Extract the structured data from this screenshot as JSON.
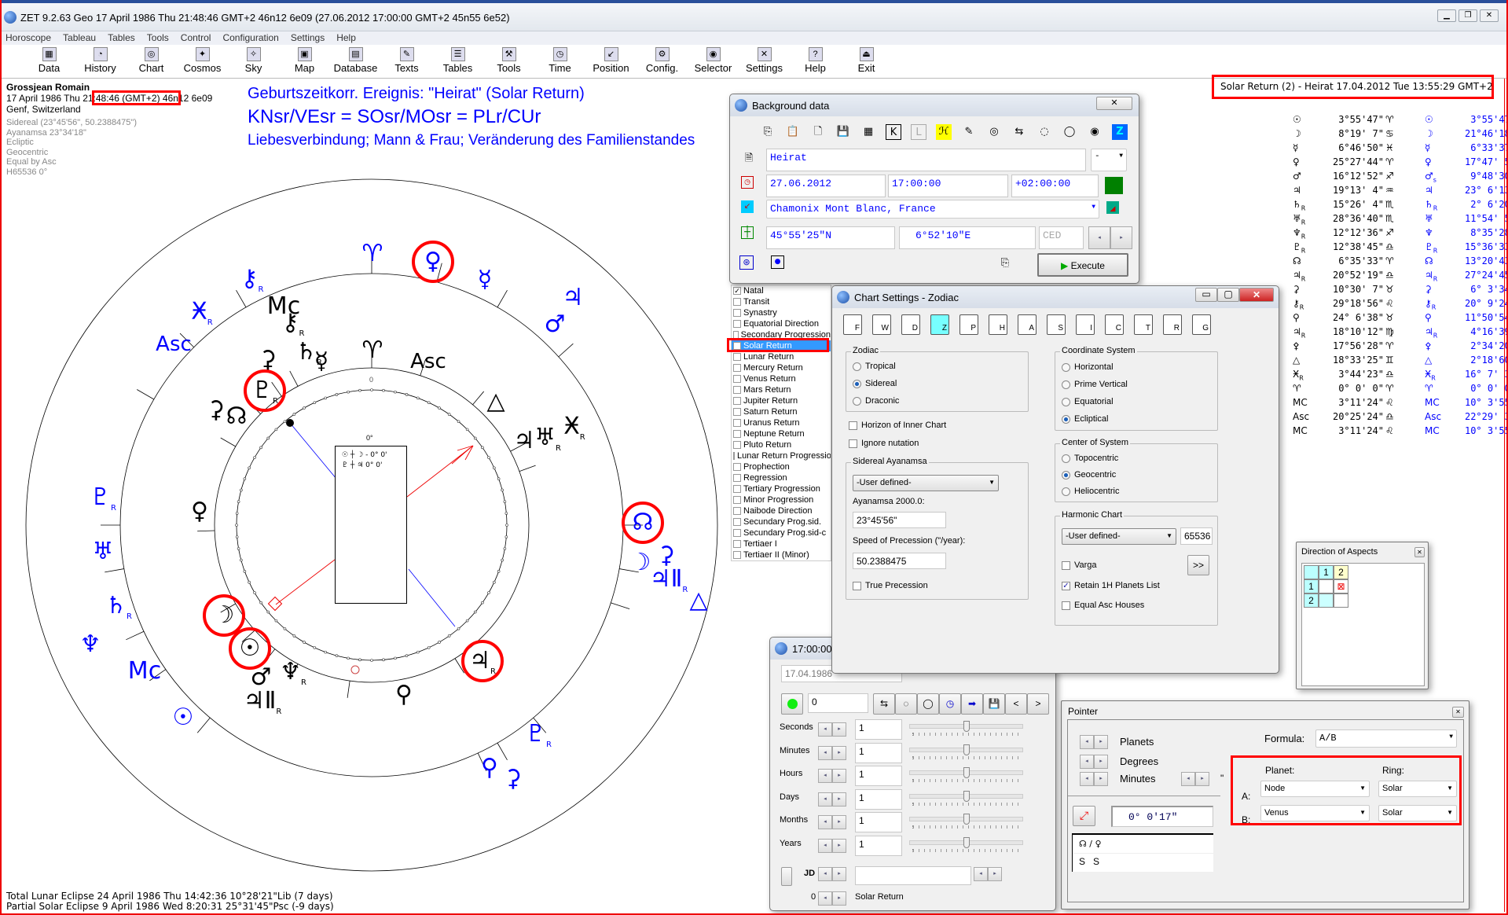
{
  "window": {
    "title": "ZET 9.2.63 Geo   17 April 1986  Thu  21:48:46 GMT+2 46n12  6e09  (27.06.2012  17:00:00 GMT+2 45n55 6e52)",
    "controls": [
      "minimize",
      "restore",
      "close"
    ]
  },
  "menu": [
    "Horoscope",
    "Tableau",
    "Tables",
    "Tools",
    "Control",
    "Configuration",
    "Settings",
    "Help"
  ],
  "toolbar": [
    {
      "label": "Data",
      "icon": "data-icon"
    },
    {
      "label": "History",
      "icon": "history-icon"
    },
    {
      "label": "Chart",
      "icon": "chart-icon"
    },
    {
      "label": "Cosmos",
      "icon": "cosmos-icon"
    },
    {
      "label": "Sky",
      "icon": "sky-icon"
    },
    {
      "label": "Map",
      "icon": "map-icon"
    },
    {
      "label": "Database",
      "icon": "database-icon"
    },
    {
      "label": "Texts",
      "icon": "texts-icon"
    },
    {
      "label": "Tables",
      "icon": "tables-icon"
    },
    {
      "label": "Tools",
      "icon": "tools-icon"
    },
    {
      "label": "Time",
      "icon": "time-icon"
    },
    {
      "label": "Position",
      "icon": "position-icon"
    },
    {
      "label": "Config.",
      "icon": "config-icon"
    },
    {
      "label": "Selector",
      "icon": "selector-icon"
    },
    {
      "label": "Settings",
      "icon": "settings-icon"
    },
    {
      "label": "Help",
      "icon": "help-icon"
    },
    {
      "label": "Exit",
      "icon": "exit-icon"
    }
  ],
  "header": {
    "name": "Grossjean Romain",
    "date": "17 April 1986  Thu ",
    "time": "21:48:46 (GMT+2)",
    "coords": " 46n12  6e09",
    "place": "Genf, Switzerland",
    "details": [
      "Sidereal (23°45'56\", 50.2388475\")",
      "Ayanamsa 23°34'18\"",
      "Ecliptic",
      "Geocentric",
      "Equal by Asc",
      "H65536   0°"
    ],
    "headings": [
      "Geburtszeitkorr. Ereignis: \"Heirat\" (Solar Return)",
      "KNsr/VEsr = SOsr/MOsr = PLr/CUr",
      "Liebesverbindung; Mann & Frau; Veränderung des Familienstandes"
    ]
  },
  "return_title": "Solar Return (2) - Heirat 17.04.2012  Tue 13:55:29 GMT+2",
  "colors": {
    "accent_blue": "#0000ff",
    "highlight_red": "#ff0000",
    "selection": "#3399ff"
  },
  "wheel": {
    "center_label": "0°",
    "center_lines": [
      "☉ ┼ ☽ - 0° 0'",
      "♇ ┼ ♃  0° 0'"
    ],
    "inner_zero": "0",
    "outer_glyphs": [
      {
        "s": "♈"
      },
      {
        "s": "♀",
        "hl": true
      },
      {
        "s": "☿"
      },
      {
        "s": "♃"
      },
      {
        "s": "♂"
      },
      {
        "s": "⚷",
        "r": "R"
      },
      {
        "s": "Ӿ",
        "r": "R"
      },
      {
        "s": "Asc"
      },
      {
        "s": "♇",
        "r": "R"
      },
      {
        "s": "♅"
      },
      {
        "s": "♄",
        "r": "R"
      },
      {
        "s": "♆"
      },
      {
        "s": "Mc"
      },
      {
        "s": "☉"
      },
      {
        "s": "♇",
        "r": "R"
      },
      {
        "s": "⚲"
      },
      {
        "s": "⚳"
      },
      {
        "s": "△"
      },
      {
        "s": "♃Ⅱ",
        "r": "R"
      },
      {
        "s": "☽"
      },
      {
        "s": "⚳"
      },
      {
        "s": "☊",
        "hl": true
      }
    ],
    "inner_glyphs": [
      {
        "s": "Mc"
      },
      {
        "s": "⚷",
        "r": "R"
      },
      {
        "s": "♄",
        "r": "R"
      },
      {
        "s": "☿"
      },
      {
        "s": "⚳"
      },
      {
        "s": "♇",
        "r": "R",
        "hl": true
      },
      {
        "s": "⚳"
      },
      {
        "s": "☊"
      },
      {
        "s": "♈"
      },
      {
        "s": "Asc"
      },
      {
        "s": "△"
      },
      {
        "s": "♃"
      },
      {
        "s": "♅",
        "r": "R"
      },
      {
        "s": "Ӿ",
        "r": "R"
      },
      {
        "s": "♀"
      },
      {
        "s": "☽",
        "hl": true
      },
      {
        "s": "☉",
        "hl": true
      },
      {
        "s": "♂"
      },
      {
        "s": "♆",
        "r": "R"
      },
      {
        "s": "♃Ⅱ",
        "r": "R"
      },
      {
        "s": "⚲"
      },
      {
        "s": "♃",
        "r": "R",
        "hl": true
      }
    ]
  },
  "planet_list": [
    [
      "☉",
      "",
      "3°55'47\"",
      "♈",
      "☉",
      "",
      "3°55'47\"",
      "♈"
    ],
    [
      "☽",
      "",
      "8°19' 7\"",
      "♋",
      "☽",
      "",
      "21°46'18\"",
      "♒"
    ],
    [
      "☿",
      "",
      "6°46'50\"",
      "♓",
      "☿",
      "",
      "6°33'37\"",
      "♓"
    ],
    [
      "♀",
      "",
      "25°27'44\"",
      "♈",
      "♀",
      "",
      "17°47' 5\"",
      "♉"
    ],
    [
      "♂",
      "",
      "16°12'52\"",
      "♐",
      "♂",
      "s",
      "9°48'30\"",
      "♌"
    ],
    [
      "♃",
      "",
      "19°13' 4\"",
      "♒",
      "♃",
      "",
      "23° 6'13\"",
      "♈"
    ],
    [
      "♄",
      "R",
      "15°26' 4\"",
      "♏",
      "♄",
      "R",
      "2° 6'20\"",
      "♎"
    ],
    [
      "♅",
      "R",
      "28°36'40\"",
      "♏",
      "♅",
      "",
      "11°54' 5\"",
      "♓"
    ],
    [
      "♆",
      "R",
      "12°12'36\"",
      "♐",
      "♆",
      "",
      "8°35'28\"",
      "♒"
    ],
    [
      "♇",
      "R",
      "12°38'45\"",
      "♎",
      "♇",
      "R",
      "15°36'33\"",
      "♐"
    ],
    [
      "☊",
      "",
      "6°35'33\"",
      "♈",
      "☊",
      "",
      "13°20'43\"",
      "♏"
    ],
    [
      "♃",
      "R",
      "20°52'19\"",
      "♎",
      "♃",
      "R",
      "27°24'45\"",
      "♏"
    ],
    [
      "⚳",
      "",
      "10°30' 7\"",
      "♉",
      "⚳",
      "",
      "6° 3'34\"",
      "♊"
    ],
    [
      "⚷",
      "R",
      "29°18'56\"",
      "♌",
      "⚷",
      "R",
      "20° 9'24\"",
      "♍"
    ],
    [
      "⚲",
      "",
      "24° 6'38\"",
      "♉",
      "⚲",
      "",
      "11°50'54\"",
      "♊"
    ],
    [
      "♃",
      "R",
      "18°10'12\"",
      "♍",
      "♃",
      "R",
      "4°16'39\"",
      "♎"
    ],
    [
      "⚴",
      "",
      "17°56'28\"",
      "♈",
      "⚴",
      "",
      "2°34'20\"",
      "♉"
    ],
    [
      "△",
      "",
      "18°33'25\"",
      "♊",
      "△",
      "",
      "2°18'60\"",
      "♋"
    ],
    [
      "Ӿ",
      "R",
      "3°44'23\"",
      "♎",
      "Ӿ",
      "R",
      "16° 7' 3\"",
      "♎"
    ],
    [
      "♈",
      "",
      "0° 0' 0\"",
      "♈",
      "♈",
      "",
      "0° 0' 0\"",
      "♈"
    ],
    [
      "MC",
      "",
      "3°11'24\"",
      "♌",
      "MC",
      "",
      "10° 3'55\"",
      "♈"
    ],
    [
      "Asc",
      "",
      "20°25'24\"",
      "♎",
      "Asc",
      "",
      "22°29' 3\"",
      "♋"
    ],
    [
      "MC",
      "",
      "3°11'24\"",
      "♌",
      "MC",
      "",
      "10° 3'55\"",
      "♈"
    ]
  ],
  "background": {
    "title": "Background data",
    "event": "Heirat",
    "event_type": "-",
    "date": "27.06.2012",
    "time": "17:00:00",
    "tz": "+02:00:00",
    "place": "Chamonix Mont Blanc, France",
    "lat": "45°55'25\"N",
    "lon": "6°52'10\"E",
    "zone": "CED",
    "execute": "Execute",
    "status_color": "#008000",
    "tools": [
      "copy",
      "paste",
      "new",
      "save",
      "calendar",
      "K",
      "L",
      "H",
      "book",
      "ring",
      "swap",
      "dot-ring",
      "ring-selected",
      "ring-filled",
      "Z"
    ]
  },
  "chart_types": {
    "checked": [
      0,
      5
    ],
    "selected": 5,
    "items": [
      "Natal",
      "Transit",
      "Synastry",
      "Equatorial Direction",
      "Secondary Progression",
      "Solar Return",
      "Lunar Return",
      "Mercury Return",
      "Venus Return",
      "Mars Return",
      "Jupiter Return",
      "Saturn Return",
      "Uranus Return",
      "Neptune Return",
      "Pluto Return",
      "Lunar Return Progression",
      "Prophection",
      "Regression",
      "Tertiary Progression",
      "Minor Progression",
      "Naibode Direction",
      "Secundary Prog.sid.",
      "Secundary Prog.sid-c",
      "Tertiaer I",
      "Tertiaer II (Minor)"
    ]
  },
  "settings": {
    "title": "Chart Settings - Zodiac",
    "tabs": [
      "F",
      "W",
      "D",
      "Z",
      "P",
      "H",
      "A",
      "S",
      "I",
      "C",
      "T",
      "R",
      "G"
    ],
    "active_tab": 3,
    "zodiac": {
      "label": "Zodiac",
      "options": [
        "Tropical",
        "Sidereal",
        "Draconic"
      ],
      "selected": 1
    },
    "horizon_inner": "Horizon of Inner Chart",
    "ignore_nutation": "Ignore nutation",
    "ayanamsa": {
      "label": "Sidereal Ayanamsa",
      "mode": "-User defined-",
      "a2000_label": "Ayanamsa 2000.0:",
      "a2000": "23°45'56\"",
      "speed_label": "Speed of Precession (\"/year):",
      "speed": "50.2388475",
      "true_precession": "True Precession"
    },
    "coord": {
      "label": "Coordinate System",
      "options": [
        "Horizontal",
        "Prime Vertical",
        "Equatorial",
        "Ecliptical"
      ],
      "selected": 3
    },
    "center": {
      "label": "Center of System",
      "options": [
        "Topocentric",
        "Geocentric",
        "Heliocentric"
      ],
      "selected": 1
    },
    "harmonic": {
      "label": "Harmonic Chart",
      "mode": "-User defined-",
      "value": "65536",
      "varga": "Varga",
      "more": ">>",
      "retain": "Retain 1H Planets List",
      "retain_checked": true,
      "equal_asc": "Equal Asc Houses"
    }
  },
  "aspects": {
    "title": "Direction of Aspects",
    "cols": [
      "1",
      "2"
    ],
    "rows": [
      "1",
      "2"
    ]
  },
  "timewin": {
    "title": "17:00:00",
    "date": "17.04.1986",
    "step": "0",
    "rows": [
      {
        "label": "Seconds",
        "value": "1"
      },
      {
        "label": "Minutes",
        "value": "1"
      },
      {
        "label": "Hours",
        "value": "1"
      },
      {
        "label": "Days",
        "value": "1"
      },
      {
        "label": "Months",
        "value": "1"
      },
      {
        "label": "Years",
        "value": "1"
      }
    ],
    "jd": "JD",
    "count": "0",
    "mode": "Solar Return",
    "slider_level": 0.5
  },
  "pointer": {
    "title": "Pointer",
    "steps": [
      "Planets",
      "Degrees",
      "Minutes"
    ],
    "sec_mark": "\"",
    "formula_label": "Formula:",
    "formula": "A/B",
    "planet_label": "Planet:",
    "ring_label": "Ring:",
    "a_label": "A:",
    "b_label": "B:",
    "a_planet": "Node",
    "a_ring": "Solar",
    "b_planet": "Venus",
    "b_ring": "Solar",
    "result": "0° 0'17\"",
    "result_formula": "☊ / ♀",
    "result_rings": "S   S"
  },
  "footer": [
    "Total Lunar Eclipse 24 April 1986 Thu 14:42:36 10°28'21\"Lib (7 days)",
    "Partial Solar Eclipse 9 April 1986 Wed  8:20:31 25°31'45\"Psc (-9 days)"
  ]
}
